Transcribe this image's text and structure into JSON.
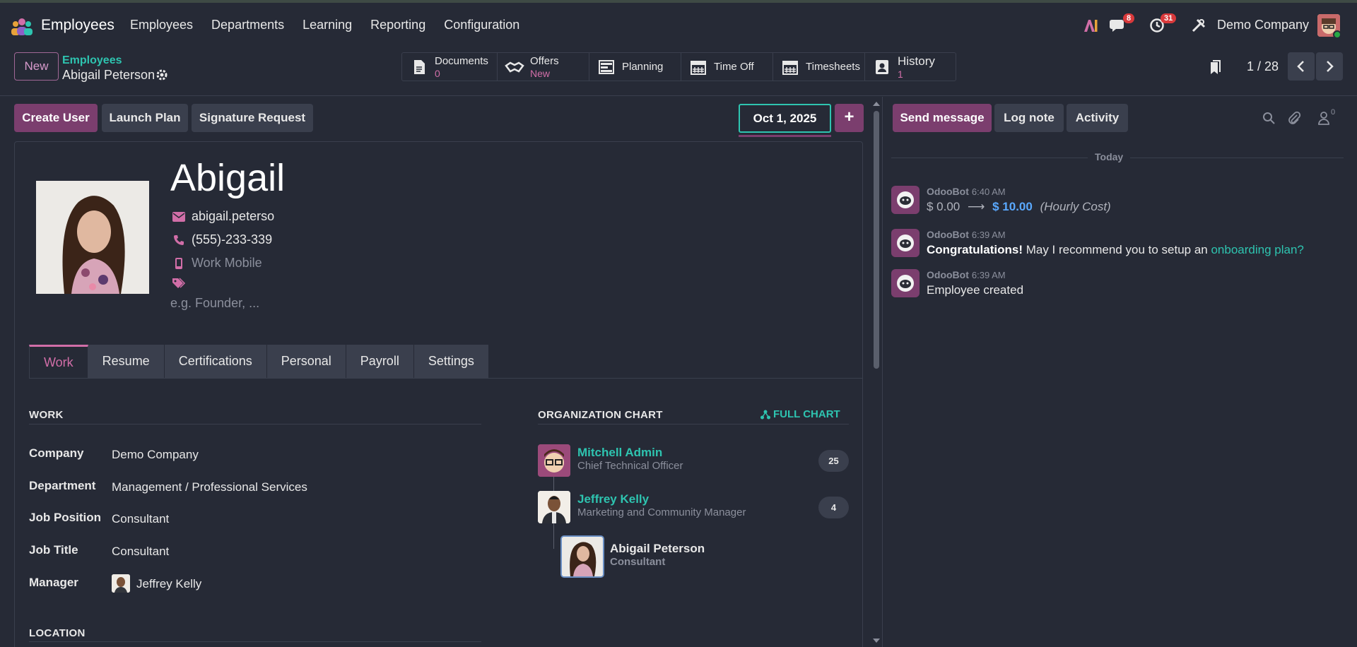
{
  "navbar": {
    "app_name": "Employees",
    "menu": [
      "Employees",
      "Departments",
      "Learning",
      "Reporting",
      "Configuration"
    ],
    "messages_count": "8",
    "activities_count": "31",
    "company": "Demo Company"
  },
  "control_panel": {
    "new_label": "New",
    "breadcrumb_parent": "Employees",
    "breadcrumb_current": "Abigail Peterson",
    "smart_buttons": [
      {
        "label": "Documents",
        "value": "0",
        "icon": "document-icon"
      },
      {
        "label": "Offers",
        "value": "New",
        "icon": "handshake-icon"
      },
      {
        "label": "Planning",
        "value": "",
        "icon": "planning-icon"
      },
      {
        "label": "Time Off",
        "value": "",
        "icon": "calendar-icon"
      },
      {
        "label": "Timesheets",
        "value": "",
        "icon": "calendar-icon"
      },
      {
        "label": "History",
        "value": "1",
        "icon": "id-card-icon"
      }
    ],
    "pager": "1 / 28"
  },
  "form": {
    "buttons": {
      "create_user": "Create User",
      "launch_plan": "Launch Plan",
      "signature_request": "Signature Request"
    },
    "date": "Oct 1, 2025",
    "plus": "+",
    "employee": {
      "name": "Abigail",
      "email": "abigail.peterso",
      "phone": "(555)-233-339",
      "work_mobile_placeholder": "Work Mobile",
      "job_placeholder": "e.g. Founder, ..."
    },
    "tabs": [
      "Work",
      "Resume",
      "Certifications",
      "Personal",
      "Payroll",
      "Settings"
    ],
    "work_section": {
      "title": "WORK",
      "fields": [
        {
          "label": "Company",
          "value": "Demo Company"
        },
        {
          "label": "Department",
          "value": "Management / Professional Services"
        },
        {
          "label": "Job Position",
          "value": "Consultant"
        },
        {
          "label": "Job Title",
          "value": "Consultant"
        },
        {
          "label": "Manager",
          "value": "Jeffrey Kelly"
        }
      ]
    },
    "location_title": "LOCATION",
    "org_chart": {
      "title": "ORGANIZATION CHART",
      "full_chart": "FULL CHART",
      "rows": [
        {
          "name": "Mitchell Admin",
          "title": "Chief Technical Officer",
          "count": "25"
        },
        {
          "name": "Jeffrey Kelly",
          "title": "Marketing and Community Manager",
          "count": "4"
        },
        {
          "name": "Abigail Peterson",
          "title": "Consultant"
        }
      ]
    }
  },
  "chatter": {
    "send_message": "Send message",
    "log_note": "Log note",
    "activity": "Activity",
    "followers_count": "0",
    "today": "Today",
    "messages": [
      {
        "author": "OdooBot",
        "time": "6:40 AM",
        "old": "$ 0.00",
        "new": "$ 10.00",
        "field": "(Hourly Cost)"
      },
      {
        "author": "OdooBot",
        "time": "6:39 AM",
        "bold": "Congratulations!",
        "text": " May I recommend you to setup an ",
        "link": "onboarding plan?"
      },
      {
        "author": "OdooBot",
        "time": "6:39 AM",
        "text": "Employee created"
      }
    ]
  }
}
